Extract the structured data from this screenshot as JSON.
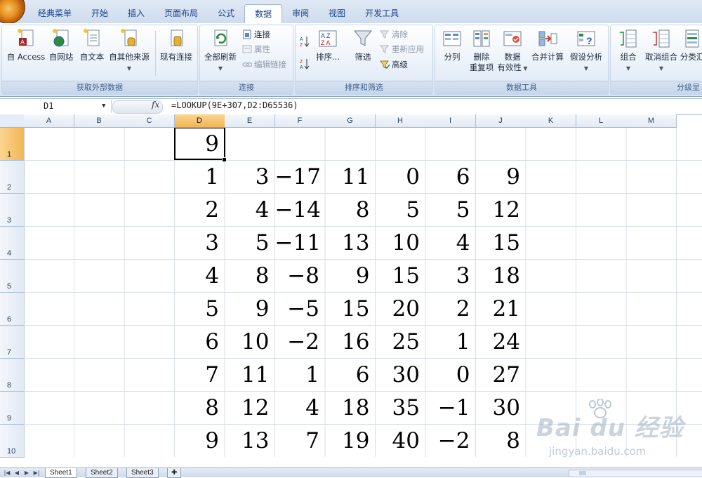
{
  "ribbon_tabs": [
    "经典菜单",
    "开始",
    "插入",
    "页面布局",
    "公式",
    "数据",
    "审阅",
    "视图",
    "开发工具"
  ],
  "active_tab": "数据",
  "groups": {
    "external": {
      "label": "获取外部数据",
      "buttons": [
        "自 Access",
        "自网站",
        "自文本",
        "自其他来源",
        "现有连接"
      ]
    },
    "connections": {
      "label": "连接",
      "refresh_all": "全部刷新",
      "connections": "连接",
      "properties": "属性",
      "edit_links": "编辑链接"
    },
    "sort_filter": {
      "label": "排序和筛选",
      "sort": "排序...",
      "filter": "筛选",
      "clear": "清除",
      "reapply": "重新应用",
      "advanced": "高级"
    },
    "data_tools": {
      "label": "数据工具",
      "text_to_columns": "分列",
      "remove_dup_1": "删除",
      "remove_dup_2": "重复项",
      "validation_1": "数据",
      "validation_2": "有效性",
      "consolidate": "合并计算",
      "what_if": "假设分析"
    },
    "outline": {
      "label": "分级显",
      "group": "组合",
      "ungroup": "取消组合",
      "subtotal": "分类汇"
    }
  },
  "formula_bar": {
    "name_box": "D1",
    "fx": "fx",
    "formula": "=LOOKUP(9E+307,D2:D65536)"
  },
  "columns": [
    "A",
    "B",
    "C",
    "D",
    "E",
    "F",
    "G",
    "H",
    "I",
    "J",
    "K",
    "L",
    "M"
  ],
  "selected_column": "D",
  "rows": [
    "1",
    "2",
    "3",
    "4",
    "5",
    "6",
    "7",
    "8",
    "9",
    "10"
  ],
  "selected_row": "1",
  "active_cell": "D1",
  "cells": {
    "D1": "9",
    "table": [
      [
        "1",
        "3",
        "−17",
        "11",
        "0",
        "6",
        "9"
      ],
      [
        "2",
        "4",
        "−14",
        "8",
        "5",
        "5",
        "12"
      ],
      [
        "3",
        "5",
        "−11",
        "13",
        "10",
        "4",
        "15"
      ],
      [
        "4",
        "8",
        "−8",
        "9",
        "15",
        "3",
        "18"
      ],
      [
        "5",
        "9",
        "−5",
        "15",
        "20",
        "2",
        "21"
      ],
      [
        "6",
        "10",
        "−2",
        "16",
        "25",
        "1",
        "24"
      ],
      [
        "7",
        "11",
        "1",
        "6",
        "30",
        "0",
        "27"
      ],
      [
        "8",
        "12",
        "4",
        "18",
        "35",
        "−1",
        "30"
      ],
      [
        "9",
        "13",
        "7",
        "19",
        "40",
        "−2",
        "8"
      ]
    ]
  },
  "sheet_tabs": [
    "Sheet1",
    "Sheet2",
    "Sheet3"
  ],
  "active_sheet": "Sheet1",
  "watermark": {
    "brand": "Bai du 经验",
    "url": "jingyan.baidu.com"
  }
}
